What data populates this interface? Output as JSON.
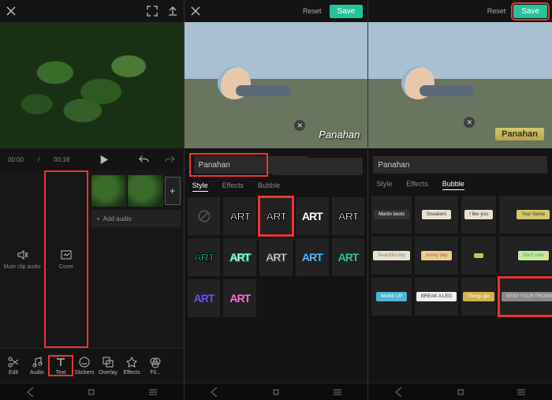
{
  "common": {
    "reset": "Reset",
    "save": "Save",
    "text_input": "Panahan",
    "caption": "Panahan",
    "tabs": {
      "style": "Style",
      "effects": "Effects",
      "bubble": "Bubble"
    },
    "art_label": "ART"
  },
  "panelA": {
    "time_current": "00:00",
    "time_total": "00:18",
    "mute_label": "Mute clip audio",
    "cover_label": "Cover",
    "add_audio": "Add audio",
    "tools": {
      "edit": "Edit",
      "audio": "Audio",
      "text": "Text",
      "stickers": "Stickers",
      "overlay": "Overlay",
      "effects": "Effects",
      "filters": "Fil..."
    }
  },
  "panelC": {
    "bubbles": [
      "Martin boots",
      "Sneakers",
      "I like you",
      "Your Name",
      "Beautiful day",
      "sunny day",
      "",
      "Don't care",
      "MAKE UP",
      "BREAK A LEG",
      "Things get",
      "KEEP YOUR PROMISES"
    ],
    "bubble_styles": [
      {
        "bg": "#333",
        "fg": "#fff"
      },
      {
        "bg": "#e8e0d0",
        "fg": "#333"
      },
      {
        "bg": "#e8e0d0",
        "fg": "#333"
      },
      {
        "bg": "#d4c86a",
        "fg": "#333"
      },
      {
        "bg": "#e8e0d0",
        "fg": "#887"
      },
      {
        "bg": "#e8d088",
        "fg": "#a55"
      },
      {
        "bg": "#d4c050",
        "fg": "#333"
      },
      {
        "bg": "#cde89a",
        "fg": "#2a6"
      },
      {
        "bg": "#4ab8d4",
        "fg": "#fff"
      },
      {
        "bg": "#eee",
        "fg": "#333"
      },
      {
        "bg": "#d4b050",
        "fg": "#fff"
      },
      {
        "bg": "#888",
        "fg": "#ddd"
      }
    ]
  },
  "art_styles": [
    {
      "color": "#fff",
      "stroke": "#000"
    },
    {
      "color": "#fff",
      "stroke": "#000"
    },
    {
      "color": "#fff",
      "stroke": "none"
    },
    {
      "color": "#fff",
      "stroke": "#000"
    },
    {
      "color": "#23c49a",
      "stroke": "#000"
    },
    {
      "color": "#fff",
      "stroke": "#23c49a"
    },
    {
      "color": "#fff",
      "stroke": "#555"
    },
    {
      "color": "#4ab8ff",
      "stroke": "none"
    },
    {
      "color": "#23c49a",
      "stroke": "none"
    },
    {
      "color": "#6a4aff",
      "stroke": "none"
    },
    {
      "color": "#ff6ad4",
      "stroke": "none"
    }
  ]
}
